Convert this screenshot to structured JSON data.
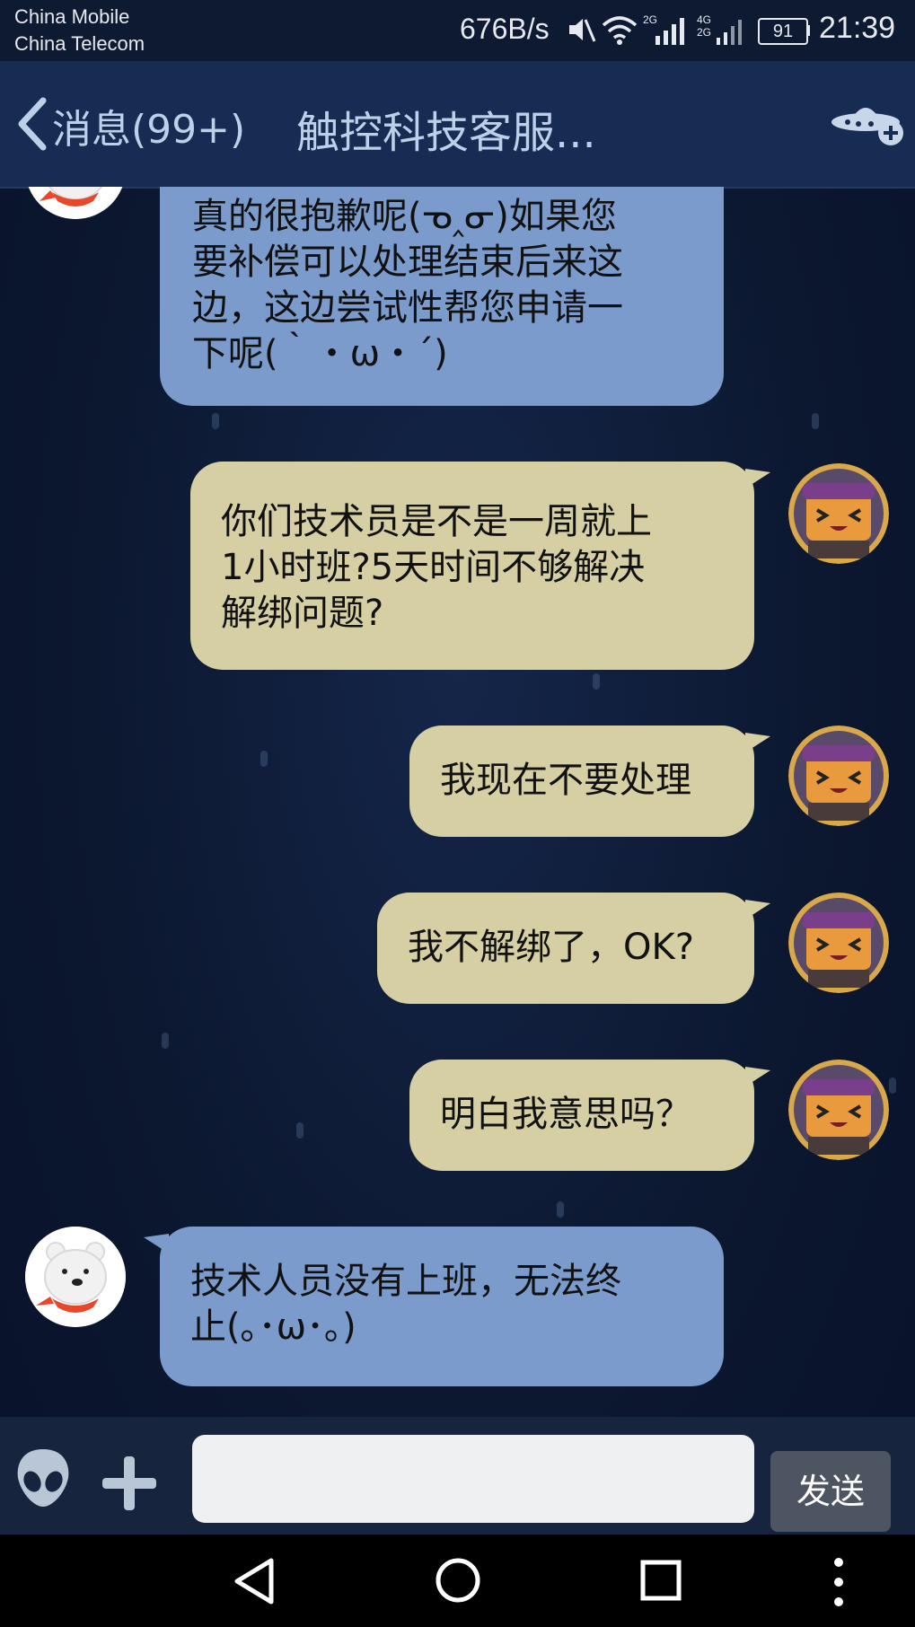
{
  "status_bar": {
    "carrier_1": "China Mobile",
    "carrier_2": "China Telecom",
    "net_speed": "676B/s",
    "battery": "91",
    "time": "21:39"
  },
  "header": {
    "back_label": "消息(99+)",
    "title": "触控科技客服...",
    "back_icon": "chevron-left-icon",
    "action_icon": "ufo-plus-icon"
  },
  "messages": [
    {
      "side": "in",
      "lines": [
        "真的很抱歉呢(ᓀ‸ᓂ)如果您",
        "要补偿可以处理结束后来这",
        "边，这边尝试性帮您申请一",
        "下呢(｀・ω・´)"
      ]
    },
    {
      "side": "out",
      "lines": [
        "你们技术员是不是一周就上",
        "1小时班?5天时间不够解决",
        "解绑问题?"
      ]
    },
    {
      "side": "out",
      "lines": [
        "我现在不要处理"
      ]
    },
    {
      "side": "out",
      "lines": [
        "我不解绑了，OK?"
      ]
    },
    {
      "side": "out",
      "lines": [
        "明白我意思吗？"
      ]
    },
    {
      "side": "in",
      "lines": [
        "技术人员没有上班，无法终",
        "止(｡･ω･｡)"
      ]
    }
  ],
  "input_bar": {
    "placeholder": "",
    "send_label": "发送",
    "left_icons": [
      "alien-emoji-icon",
      "plus-icon"
    ]
  },
  "nav_bar": {
    "icons": [
      "back-triangle-icon",
      "home-circle-icon",
      "recent-square-icon",
      "more-vertical-icon"
    ]
  },
  "colors": {
    "incoming_bubble": "#7a9bcc",
    "outgoing_bubble": "#d6cfa4",
    "header_bg": "#172c52",
    "background": "#0d1a33"
  }
}
